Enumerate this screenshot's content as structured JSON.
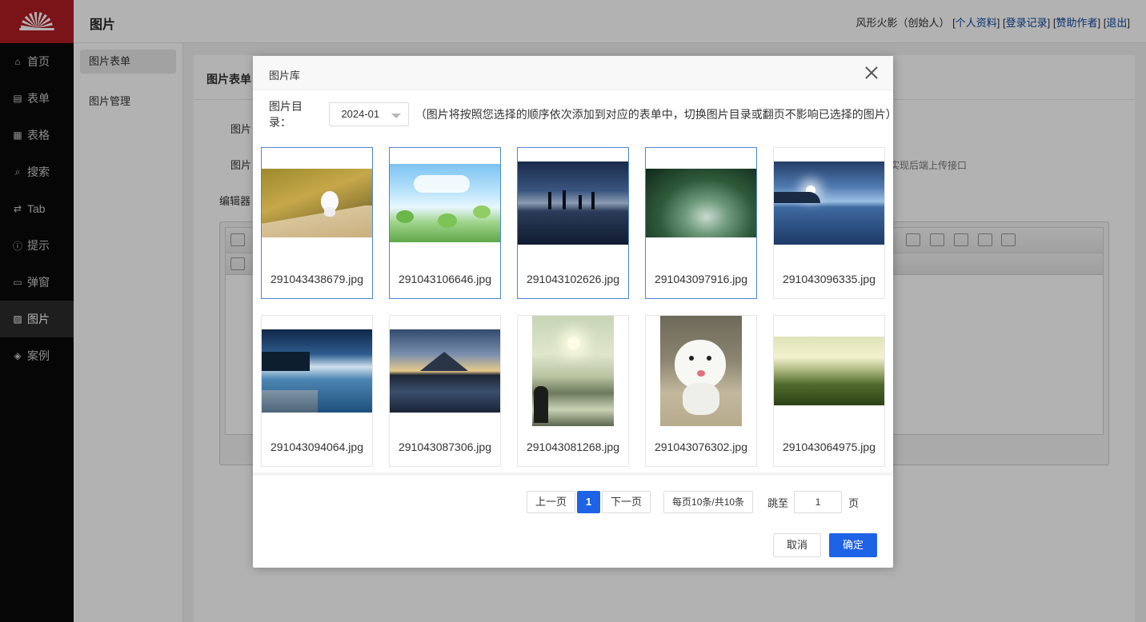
{
  "nav": {
    "items": [
      {
        "label": "首页",
        "icon": "home-icon"
      },
      {
        "label": "表单",
        "icon": "form-icon"
      },
      {
        "label": "表格",
        "icon": "table-icon"
      },
      {
        "label": "搜索",
        "icon": "search-icon"
      },
      {
        "label": "Tab",
        "icon": "switch-icon"
      },
      {
        "label": "提示",
        "icon": "info-icon"
      },
      {
        "label": "弹窗",
        "icon": "window-icon"
      },
      {
        "label": "图片",
        "icon": "image-icon"
      },
      {
        "label": "案例",
        "icon": "layers-icon"
      }
    ],
    "active_index": 7
  },
  "header": {
    "title": "图片",
    "user": "风形火影（创始人）",
    "links": [
      "个人资料",
      "登录记录",
      "赞助作者",
      "退出"
    ]
  },
  "submenu": {
    "items": [
      "图片表单",
      "图片管理"
    ]
  },
  "background_page": {
    "panel_title": "图片表单",
    "field_labels": [
      "图片",
      "图片",
      "编辑器"
    ],
    "hint_fragment": "实现后端上传接口"
  },
  "modal": {
    "title": "图片库",
    "filter_label": "图片目录：",
    "directory": "2024-01",
    "note": "（图片将按照您选择的顺序依次添加到对应的表单中，切换图片目录或翻页不影响已选择的图片）",
    "images": [
      {
        "name": "291043438679.jpg",
        "selected": true
      },
      {
        "name": "291043106646.jpg",
        "selected": true
      },
      {
        "name": "291043102626.jpg",
        "selected": true
      },
      {
        "name": "291043097916.jpg",
        "selected": true
      },
      {
        "name": "291043096335.jpg",
        "selected": false
      },
      {
        "name": "291043094064.jpg",
        "selected": false
      },
      {
        "name": "291043087306.jpg",
        "selected": false
      },
      {
        "name": "291043081268.jpg",
        "selected": false
      },
      {
        "name": "291043076302.jpg",
        "selected": false
      },
      {
        "name": "291043064975.jpg",
        "selected": false
      }
    ],
    "pager": {
      "prev": "上一页",
      "current_page": "1",
      "next": "下一页",
      "info": "每页10条/共10条",
      "jump_label": "跳至",
      "jump_value": "1",
      "unit": "页"
    },
    "cancel": "取消",
    "confirm": "确定"
  },
  "colors": {
    "brand": "#b01e25",
    "primary": "#1e62e6",
    "selected_border": "#4a88d8",
    "link": "#0d47a1"
  }
}
